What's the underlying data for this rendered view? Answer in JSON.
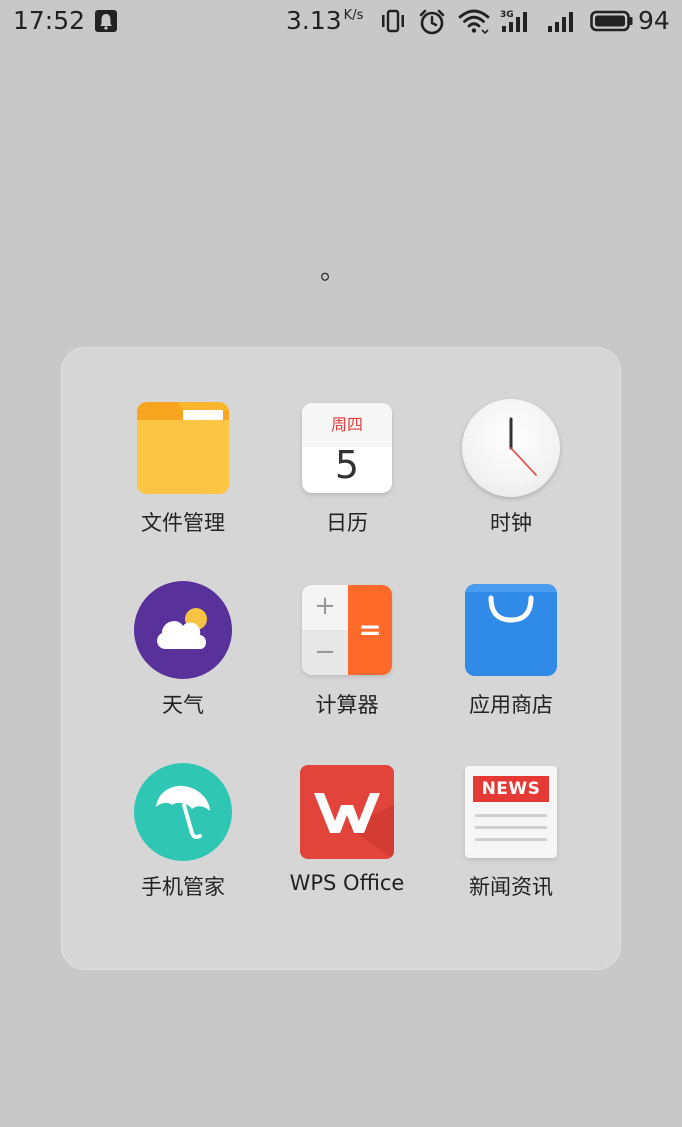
{
  "status_bar": {
    "time": "17:52",
    "net_speed": "3.13",
    "net_speed_unit": "K/s",
    "battery": "94",
    "icons": [
      "notification-icon",
      "vibrate-icon",
      "alarm-icon",
      "wifi-icon",
      "cellular-3g-icon",
      "cellular-icon",
      "battery-icon"
    ]
  },
  "folder": {
    "title": "。",
    "apps": [
      {
        "label": "文件管理",
        "icon": "folder-icon"
      },
      {
        "label": "日历",
        "icon": "calendar-icon",
        "weekday": "周四",
        "day": "5"
      },
      {
        "label": "时钟",
        "icon": "clock-icon"
      },
      {
        "label": "天气",
        "icon": "weather-icon"
      },
      {
        "label": "计算器",
        "icon": "calculator-icon",
        "plus": "+",
        "minus": "−",
        "equals": "="
      },
      {
        "label": "应用商店",
        "icon": "app-store-icon"
      },
      {
        "label": "手机管家",
        "icon": "umbrella-icon"
      },
      {
        "label": "WPS Office",
        "icon": "wps-icon"
      },
      {
        "label": "新闻资讯",
        "icon": "news-icon",
        "badge": "NEWS"
      }
    ]
  },
  "colors": {
    "background": "#c8c8c8",
    "folder_panel": "#d6d6d6",
    "files": "#fbb72c",
    "weather": "#58329a",
    "calculator_accent": "#ff6a2b",
    "store": "#2f8ae8",
    "guard": "#2fc7b4",
    "wps": "#e2443b",
    "news_badge": "#e53935"
  }
}
